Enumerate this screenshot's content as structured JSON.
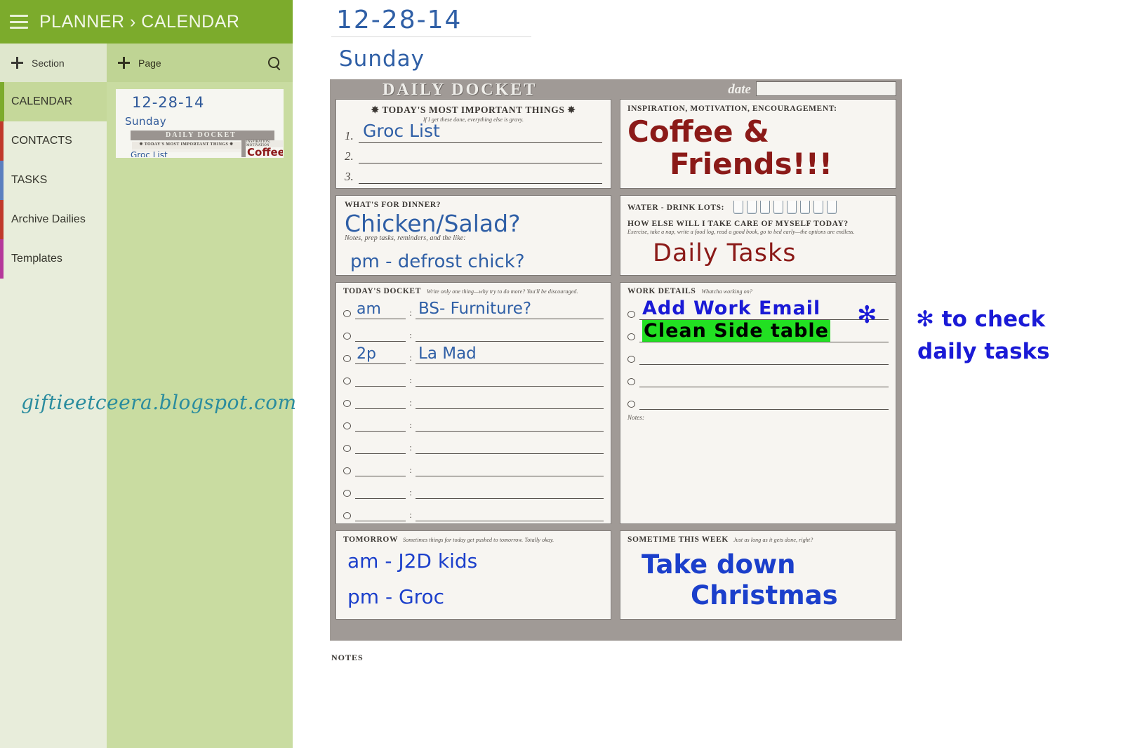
{
  "app": {
    "title": "PLANNER › CALENDAR",
    "header_color": "#7CAB2C",
    "menu_icon": "hamburger-icon"
  },
  "sidebar": {
    "add_section_label": "Section",
    "items": [
      {
        "label": "CALENDAR",
        "color": "#7CAB2C",
        "selected": true
      },
      {
        "label": "CONTACTS",
        "color": "#C0392B",
        "selected": false
      },
      {
        "label": "TASKS",
        "color": "#5B7FBF",
        "selected": false
      },
      {
        "label": "Archive Dailies",
        "color": "#C0392B",
        "selected": false
      },
      {
        "label": "Templates",
        "color": "#B5389B",
        "selected": false
      }
    ]
  },
  "pagepane": {
    "add_page_label": "Page",
    "search_icon": "search-icon",
    "thumbnail": {
      "date": "12-28-14",
      "day": "Sunday",
      "docket_title": "DAILY DOCKET",
      "tmit_label": "✸ TODAY'S MOST IMPORTANT THINGS ✸",
      "first_item": "Groc List",
      "insp_label": "INSPIRATION, MOTIVATION",
      "insp_hw": "Coffee"
    }
  },
  "canvas": {
    "hw_date": "12-28-14",
    "hw_day": "Sunday",
    "watermark": "giftieetceera.blogspot.com",
    "annotation": {
      "line1": "✻ to check",
      "line2": "daily tasks"
    },
    "notes_label": "NOTES"
  },
  "docket": {
    "title": "DAILY DOCKET",
    "date_label": "date",
    "date_value": "",
    "tmit": {
      "header": "✸ TODAY'S MOST IMPORTANT THINGS ✸",
      "subtitle": "If I get these done, everything else is gravy.",
      "items": [
        {
          "num": "1.",
          "value": "Groc List"
        },
        {
          "num": "2.",
          "value": ""
        },
        {
          "num": "3.",
          "value": ""
        }
      ]
    },
    "inspiration": {
      "label": "INSPIRATION, MOTIVATION, ENCOURAGEMENT:",
      "line1": "Coffee &",
      "line2": "Friends!!!"
    },
    "dinner": {
      "label": "WHAT'S FOR DINNER?",
      "value": "Chicken/Salad?",
      "subtitle": "Notes, prep tasks, reminders, and the like:",
      "note": "pm - defrost chick?"
    },
    "water": {
      "label": "WATER - DRINK LOTS:",
      "glass_count": 8,
      "selfcare_label": "HOW ELSE WILL I TAKE CARE OF MYSELF TODAY?",
      "selfcare_subtitle": "Exercise, take a nap, write a food log, read a good book, go to bed early—the options are endless.",
      "value": "Daily Tasks"
    },
    "todays_docket": {
      "label": "TODAY'S DOCKET",
      "subtitle": "Write only one thing—why try to do more? You'll be discouraged.",
      "rows": [
        {
          "time": "am",
          "task": "BS- Furniture?"
        },
        {
          "time": "",
          "task": ""
        },
        {
          "time": "2p",
          "task": "La Mad"
        },
        {
          "time": "",
          "task": ""
        },
        {
          "time": "",
          "task": ""
        },
        {
          "time": "",
          "task": ""
        },
        {
          "time": "",
          "task": ""
        },
        {
          "time": "",
          "task": ""
        },
        {
          "time": "",
          "task": ""
        },
        {
          "time": "",
          "task": ""
        }
      ]
    },
    "work_details": {
      "label": "WORK DETAILS",
      "subtitle": "Whatcha working on?",
      "star": "✻",
      "rows": [
        {
          "value": "Add Work Email",
          "highlight": false
        },
        {
          "value": "Clean Side table",
          "highlight": true
        },
        {
          "value": "",
          "highlight": false
        },
        {
          "value": "",
          "highlight": false
        },
        {
          "value": "",
          "highlight": false
        }
      ],
      "notes_label": "Notes:"
    },
    "tomorrow": {
      "label": "TOMORROW",
      "subtitle": "Sometimes things for today get pushed to tomorrow. Totally okay.",
      "line1": "am - J2D kids",
      "line2": "pm - Groc"
    },
    "this_week": {
      "label": "SOMETIME THIS WEEK",
      "subtitle": "Just as long as it gets done, right?",
      "line1": "Take down",
      "line2": "Christmas"
    }
  }
}
